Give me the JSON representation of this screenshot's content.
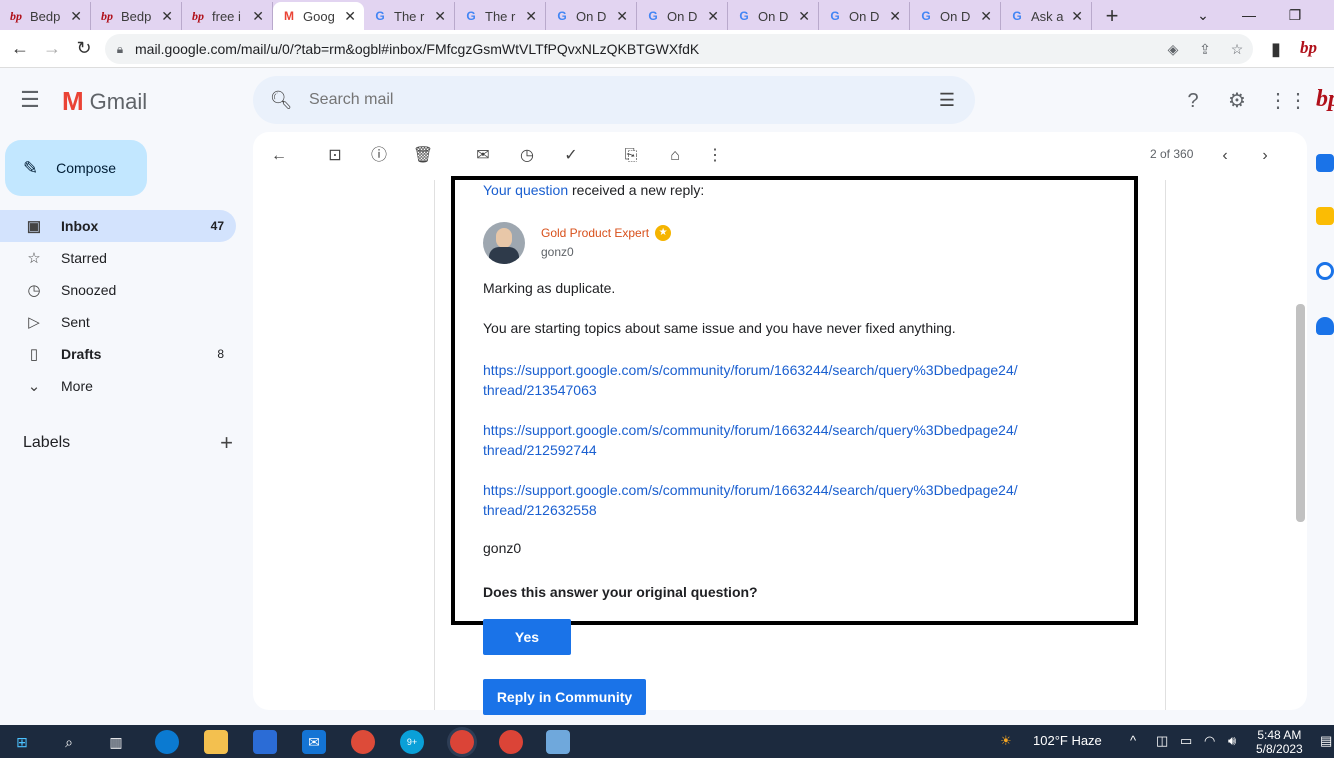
{
  "browser": {
    "tabs": [
      {
        "title": "Bedp",
        "icon": "bp-icon"
      },
      {
        "title": "Bedp",
        "icon": "bp-icon"
      },
      {
        "title": "free i",
        "icon": "bp-icon"
      },
      {
        "title": "Goog",
        "icon": "gmail-icon",
        "active": true
      },
      {
        "title": "The r",
        "icon": "google-icon"
      },
      {
        "title": "The r",
        "icon": "google-icon"
      },
      {
        "title": "On D",
        "icon": "google-icon"
      },
      {
        "title": "On D",
        "icon": "google-icon"
      },
      {
        "title": "On D",
        "icon": "google-icon"
      },
      {
        "title": "On D",
        "icon": "google-icon"
      },
      {
        "title": "On D",
        "icon": "google-icon"
      },
      {
        "title": "Ask a",
        "icon": "google-icon"
      }
    ],
    "url": "mail.google.com/mail/u/0/?tab=rm&ogbl#inbox/FMfcgzGsmWtVLTfPQvxNLzQKBTGWXfdK",
    "ext_label": "bp"
  },
  "gmail": {
    "brand": "Gmail",
    "search_placeholder": "Search mail",
    "compose": "Compose",
    "nav": [
      {
        "label": "Inbox",
        "count": "47",
        "icon": "inbox-icon"
      },
      {
        "label": "Starred",
        "count": "",
        "icon": "star-icon"
      },
      {
        "label": "Snoozed",
        "count": "",
        "icon": "clock-icon"
      },
      {
        "label": "Sent",
        "count": "",
        "icon": "send-icon"
      },
      {
        "label": "Drafts",
        "count": "8",
        "icon": "draft-icon"
      },
      {
        "label": "More",
        "count": "",
        "icon": "chevron-down-icon"
      }
    ],
    "labels_heading": "Labels",
    "pager": "2 of 360",
    "right_logo": "bp"
  },
  "email": {
    "intro_link": "Your question",
    "intro_rest": " received a new reply:",
    "expert_badge": "Gold Product Expert",
    "username": "gonz0",
    "line1": "Marking as duplicate.",
    "line2": "You are starting topics about same issue and you have never fixed anything.",
    "links": [
      {
        "a": "https://support.google.com/s/community/forum/1663244/search/query%3Dbedpage24/",
        "b": "thread/213547063"
      },
      {
        "a": "https://support.google.com/s/community/forum/1663244/search/query%3Dbedpage24/",
        "b": "thread/212592744"
      },
      {
        "a": "https://support.google.com/s/community/forum/1663244/search/query%3Dbedpage24/",
        "b": "thread/212632558"
      }
    ],
    "signature": "gonz0",
    "question": "Does this answer your original question?",
    "yes_button": "Yes",
    "reply_button": "Reply in Community"
  },
  "taskbar": {
    "weather": "102°F  Haze",
    "time": "5:48 AM",
    "date": "5/8/2023",
    "badge": "9+"
  }
}
